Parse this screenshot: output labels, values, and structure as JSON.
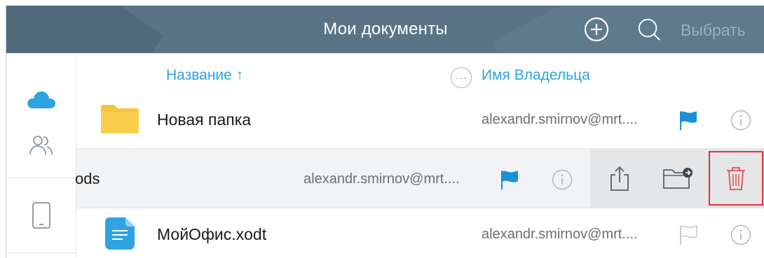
{
  "header": {
    "title": "Мои документы",
    "select_label": "Выбрать"
  },
  "columns": {
    "name_label": "Название ↑",
    "owner_label": "Имя Владельца",
    "more_label": "···"
  },
  "rows": [
    {
      "name": "Новая папка",
      "owner": "alexandr.smirnov@mrt....",
      "type": "folder",
      "flag": "flagged"
    },
    {
      "name": "ods",
      "owner": "alexandr.smirnov@mrt....",
      "type": "spreadsheet",
      "flag": "flagged",
      "swiped": true
    },
    {
      "name": "МойОфис.xodt",
      "owner": "alexandr.smirnov@mrt....",
      "type": "text-document",
      "flag": "unflagged"
    }
  ],
  "colors": {
    "header_bg": "#5a7485",
    "accent": "#2ea3e0",
    "flag_blue": "#1a8fd8",
    "folder_yellow": "#f6c33c",
    "delete_highlight": "#e2323a"
  },
  "icons": {
    "header": [
      "add-icon",
      "search-icon"
    ],
    "sidebar": [
      "cloud-icon",
      "people-icon",
      "tablet-icon"
    ],
    "row_actions": [
      "share-icon",
      "move-to-folder-icon",
      "trash-icon"
    ]
  }
}
